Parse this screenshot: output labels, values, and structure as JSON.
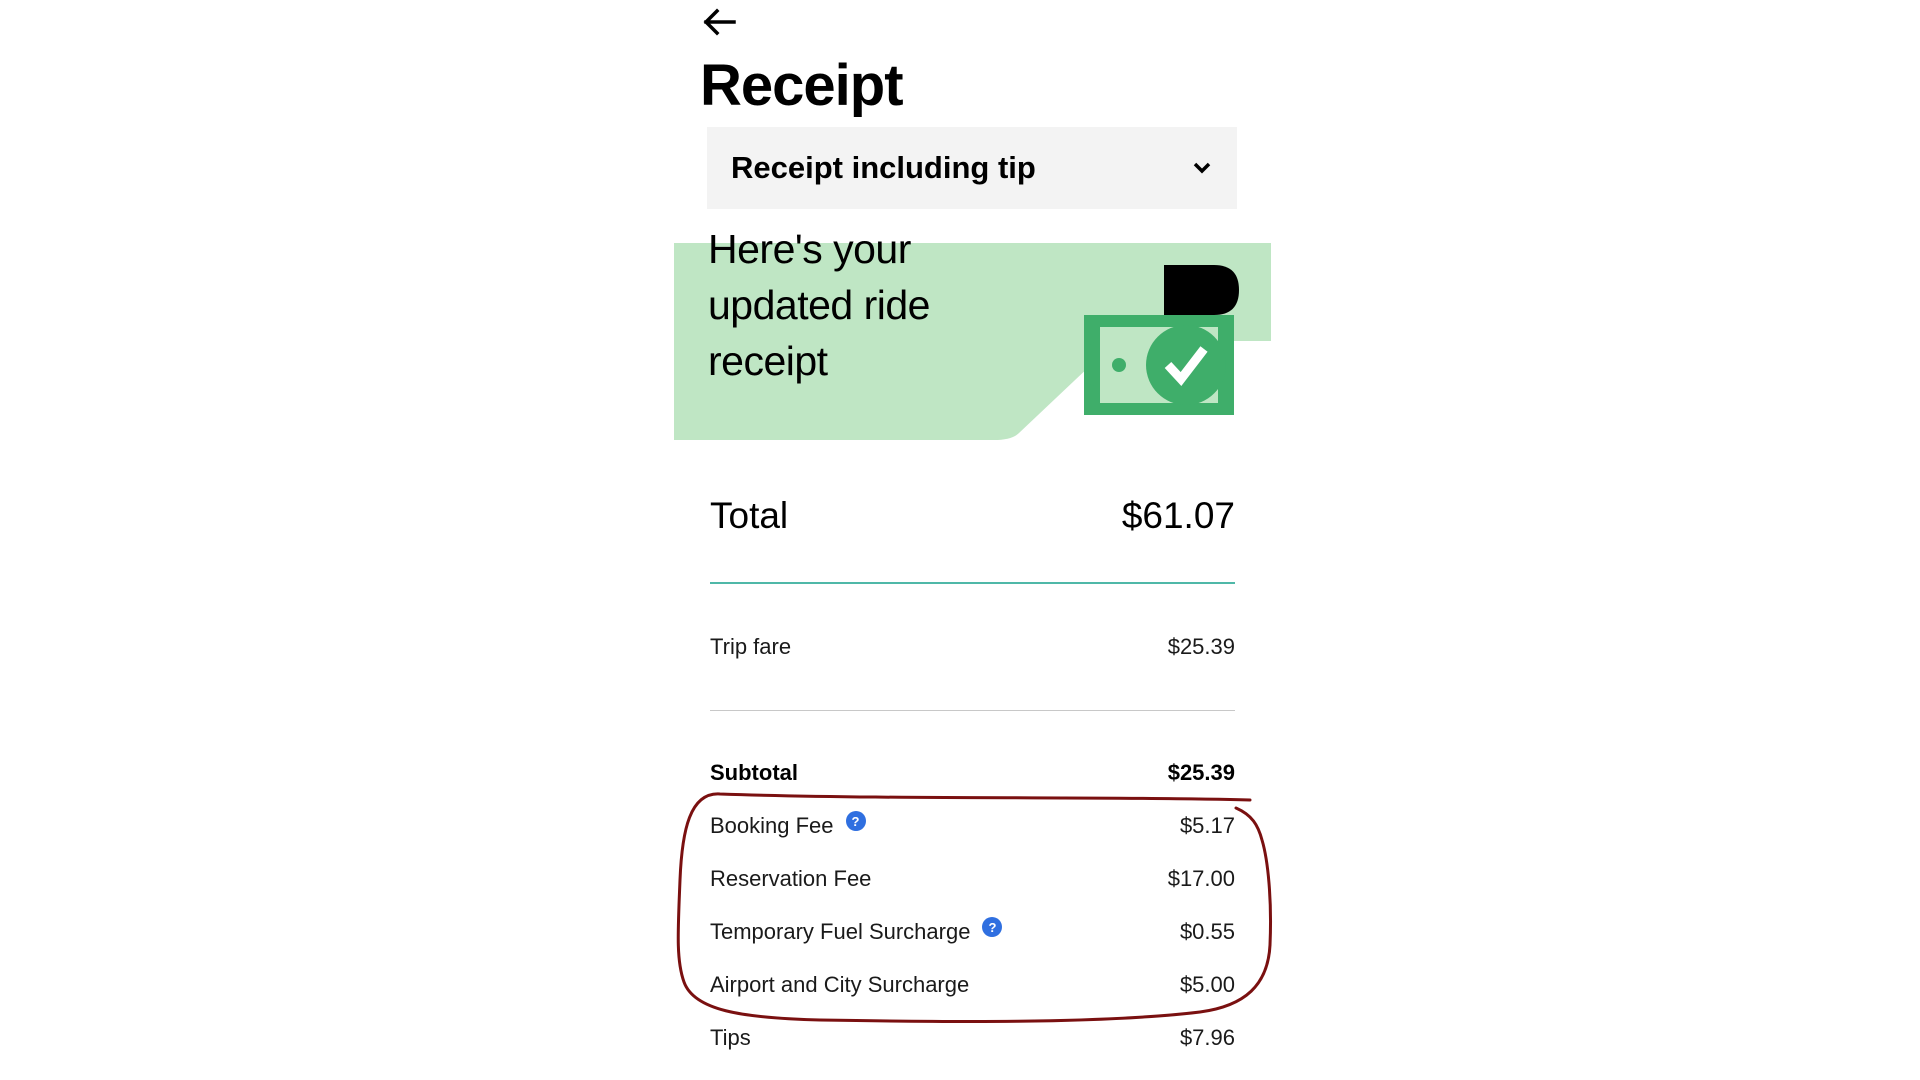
{
  "header": {
    "back_icon": "arrow-left-icon",
    "title": "Receipt"
  },
  "receipt_select": {
    "value": "Receipt including tip",
    "icon": "chevron-down-icon"
  },
  "banner": {
    "line1": "Here's your",
    "line2": "updated ride",
    "line3": "receipt",
    "illustration": "cash-check-illustration",
    "colors": {
      "background": "#bfe6c4",
      "accent": "#3fae6a",
      "dark": "#000000"
    }
  },
  "total": {
    "label": "Total",
    "value": "$61.07"
  },
  "lines": [
    {
      "label": "Trip fare",
      "value": "$25.39"
    },
    {
      "label": "Subtotal",
      "value": "$25.39"
    },
    {
      "label": "Booking Fee",
      "value": "$5.17",
      "help_icon": "?"
    },
    {
      "label": "Reservation Fee",
      "value": "$17.00"
    },
    {
      "label": "Temporary Fuel Surcharge",
      "value": "$0.55",
      "help_icon": "?"
    },
    {
      "label": "Airport and City Surcharge",
      "value": "$5.00"
    },
    {
      "label": "Tips",
      "value": "$7.96"
    }
  ],
  "colors": {
    "divider_teal": "#4fb8a8",
    "divider_grey": "#c8c8c8",
    "help_blue": "#2f6fe0",
    "annotation_red": "#7a1010"
  }
}
